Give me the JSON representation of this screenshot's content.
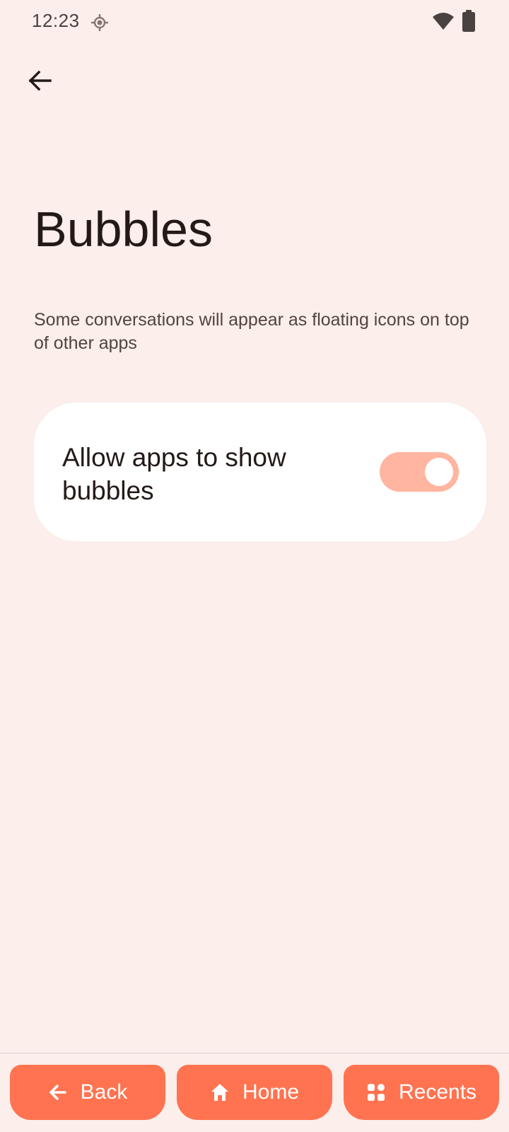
{
  "status_bar": {
    "time": "12:23",
    "location_icon": "location-icon",
    "wifi_icon": "wifi-icon",
    "battery_icon": "battery-icon"
  },
  "header": {
    "back_icon": "arrow-back-icon"
  },
  "page": {
    "title": "Bubbles",
    "description": "Some conversations will appear as floating icons on top of other apps"
  },
  "setting": {
    "label": "Allow apps to show bubbles",
    "toggle_state": "on"
  },
  "nav": {
    "back_label": "Back",
    "home_label": "Home",
    "recents_label": "Recents"
  },
  "colors": {
    "background": "#fbeeeb",
    "card": "#ffffff",
    "accent": "#ff7350",
    "toggle_track": "#ffb5a0"
  }
}
